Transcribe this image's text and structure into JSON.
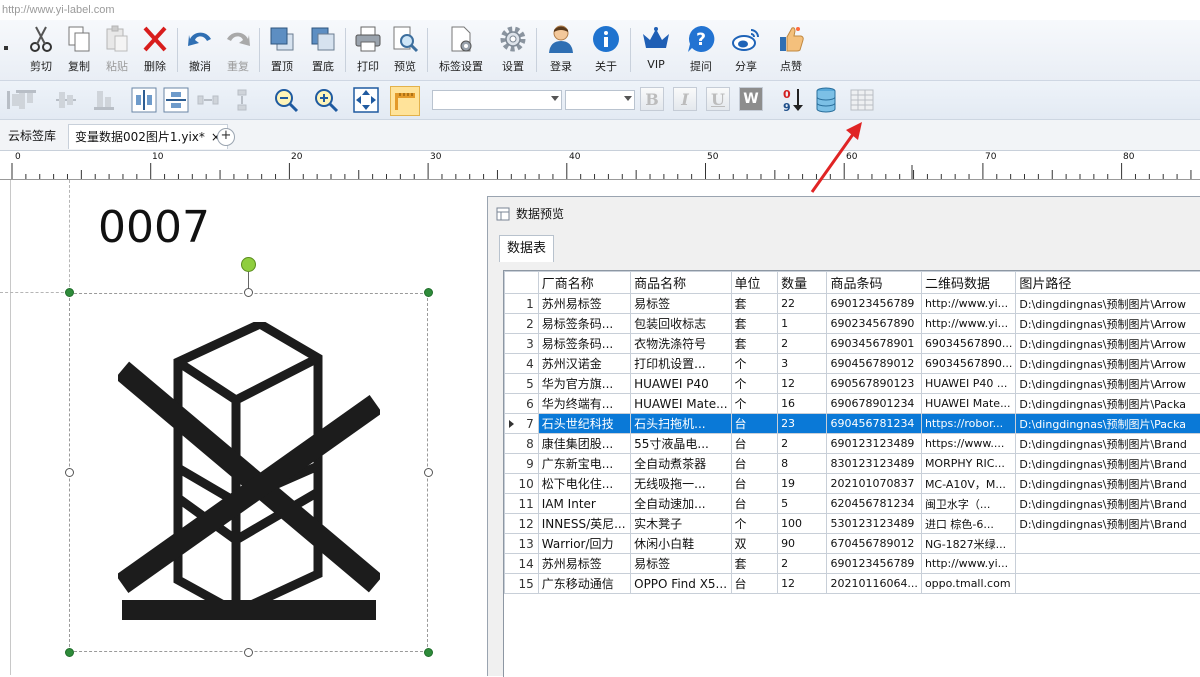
{
  "window": {
    "url": "http://www.yi-label.com"
  },
  "toolbar": {
    "buttons": [
      {
        "label": "剪切",
        "icon": "scissors-icon",
        "enabled": true
      },
      {
        "label": "复制",
        "icon": "copy-icon",
        "enabled": true
      },
      {
        "label": "粘贴",
        "icon": "paste-icon",
        "enabled": false
      },
      {
        "label": "删除",
        "icon": "delete-icon",
        "enabled": true
      },
      {
        "label": "撤消",
        "icon": "undo-icon",
        "enabled": true
      },
      {
        "label": "重复",
        "icon": "redo-icon",
        "enabled": false
      },
      {
        "label": "置顶",
        "icon": "bring-to-front-icon",
        "enabled": true
      },
      {
        "label": "置底",
        "icon": "send-to-back-icon",
        "enabled": true
      },
      {
        "label": "打印",
        "icon": "printer-icon",
        "enabled": true
      },
      {
        "label": "预览",
        "icon": "preview-icon",
        "enabled": true
      },
      {
        "label": "标签设置",
        "icon": "label-settings-icon",
        "enabled": true
      },
      {
        "label": "设置",
        "icon": "gear-icon",
        "enabled": true
      },
      {
        "label": "登录",
        "icon": "user-login-icon",
        "enabled": true
      },
      {
        "label": "关于",
        "icon": "info-icon",
        "enabled": true
      },
      {
        "label": "VIP",
        "icon": "crown-icon",
        "enabled": true
      },
      {
        "label": "提问",
        "icon": "question-icon",
        "enabled": true
      },
      {
        "label": "分享",
        "icon": "weibo-icon",
        "enabled": true
      },
      {
        "label": "点赞",
        "icon": "thumbs-up-icon",
        "enabled": true
      }
    ]
  },
  "format_toolbar": {
    "bold": "B",
    "italic": "I",
    "underline": "U",
    "word": "W",
    "sort_digits": "0 9"
  },
  "tabs": {
    "cloud_library": "云标签库",
    "document": "变量数据002图片1.yix*",
    "close": "×",
    "add": "+"
  },
  "ruler": {
    "marks": [
      "0",
      "10",
      "20",
      "30",
      "40",
      "50",
      "60",
      "70",
      "80"
    ]
  },
  "label": {
    "number_text": "0007"
  },
  "preview": {
    "title": "数据预览",
    "tab": "数据表",
    "selected_row": 7,
    "columns": [
      "厂商名称",
      "商品名称",
      "单位",
      "数量",
      "商品条码",
      "二维码数据",
      "图片路径"
    ],
    "rows": [
      [
        "1",
        "苏州易标签",
        "易标签",
        "套",
        "22",
        "690123456789",
        "http://www.yi...",
        "D:\\dingdingnas\\预制图片\\Arrow"
      ],
      [
        "2",
        "易标签条码...",
        "包装回收标志",
        "套",
        "1",
        "690234567890",
        "http://www.yi...",
        "D:\\dingdingnas\\预制图片\\Arrow"
      ],
      [
        "3",
        "易标签条码...",
        "衣物洗涤符号",
        "套",
        "2",
        "690345678901",
        "69034567890...",
        "D:\\dingdingnas\\预制图片\\Arrow"
      ],
      [
        "4",
        "苏州汉诺金",
        "打印机设置...",
        "个",
        "3",
        "690456789012",
        "69034567890...",
        "D:\\dingdingnas\\预制图片\\Arrow"
      ],
      [
        "5",
        "华为官方旗...",
        "HUAWEI P40",
        "个",
        "12",
        "690567890123",
        "HUAWEI P40 ...",
        "D:\\dingdingnas\\预制图片\\Arrow"
      ],
      [
        "6",
        "华为终端有...",
        "HUAWEI Mate...",
        "个",
        "16",
        "690678901234",
        "HUAWEI Mate...",
        "D:\\dingdingnas\\预制图片\\Packa"
      ],
      [
        "7",
        "石头世纪科技",
        "石头扫拖机...",
        "台",
        "23",
        "690456781234",
        "https://robor...",
        "D:\\dingdingnas\\预制图片\\Packa"
      ],
      [
        "8",
        "康佳集团股...",
        "55寸液晶电...",
        "台",
        "2",
        "690123123489",
        "https://www....",
        "D:\\dingdingnas\\预制图片\\Brand"
      ],
      [
        "9",
        "广东新宝电...",
        "全自动煮茶器",
        "台",
        "8",
        "830123123489",
        "MORPHY RIC...",
        "D:\\dingdingnas\\预制图片\\Brand"
      ],
      [
        "10",
        "松下电化住...",
        "无线吸拖一...",
        "台",
        "19",
        "202101070837",
        "MC-A10V，M...",
        "D:\\dingdingnas\\预制图片\\Brand"
      ],
      [
        "11",
        "IAM Inter",
        "全自动速加...",
        "台",
        "5",
        "620456781234",
        "闽卫水字（...",
        "D:\\dingdingnas\\预制图片\\Brand"
      ],
      [
        "12",
        "INNESS/英尼...",
        "实木凳子",
        "个",
        "100",
        "530123123489",
        "进口 棕色-6...",
        "D:\\dingdingnas\\预制图片\\Brand"
      ],
      [
        "13",
        "Warrior/回力",
        "休闲小白鞋",
        "双",
        "90",
        "670456789012",
        "NG-1827米绿...",
        ""
      ],
      [
        "14",
        "苏州易标签",
        "易标签",
        "套",
        "2",
        "690123456789",
        "http://www.yi...",
        ""
      ],
      [
        "15",
        "广东移动通信",
        "OPPO Find X5...",
        "台",
        "12",
        "20210116064...",
        "oppo.tmall.com",
        ""
      ]
    ]
  }
}
